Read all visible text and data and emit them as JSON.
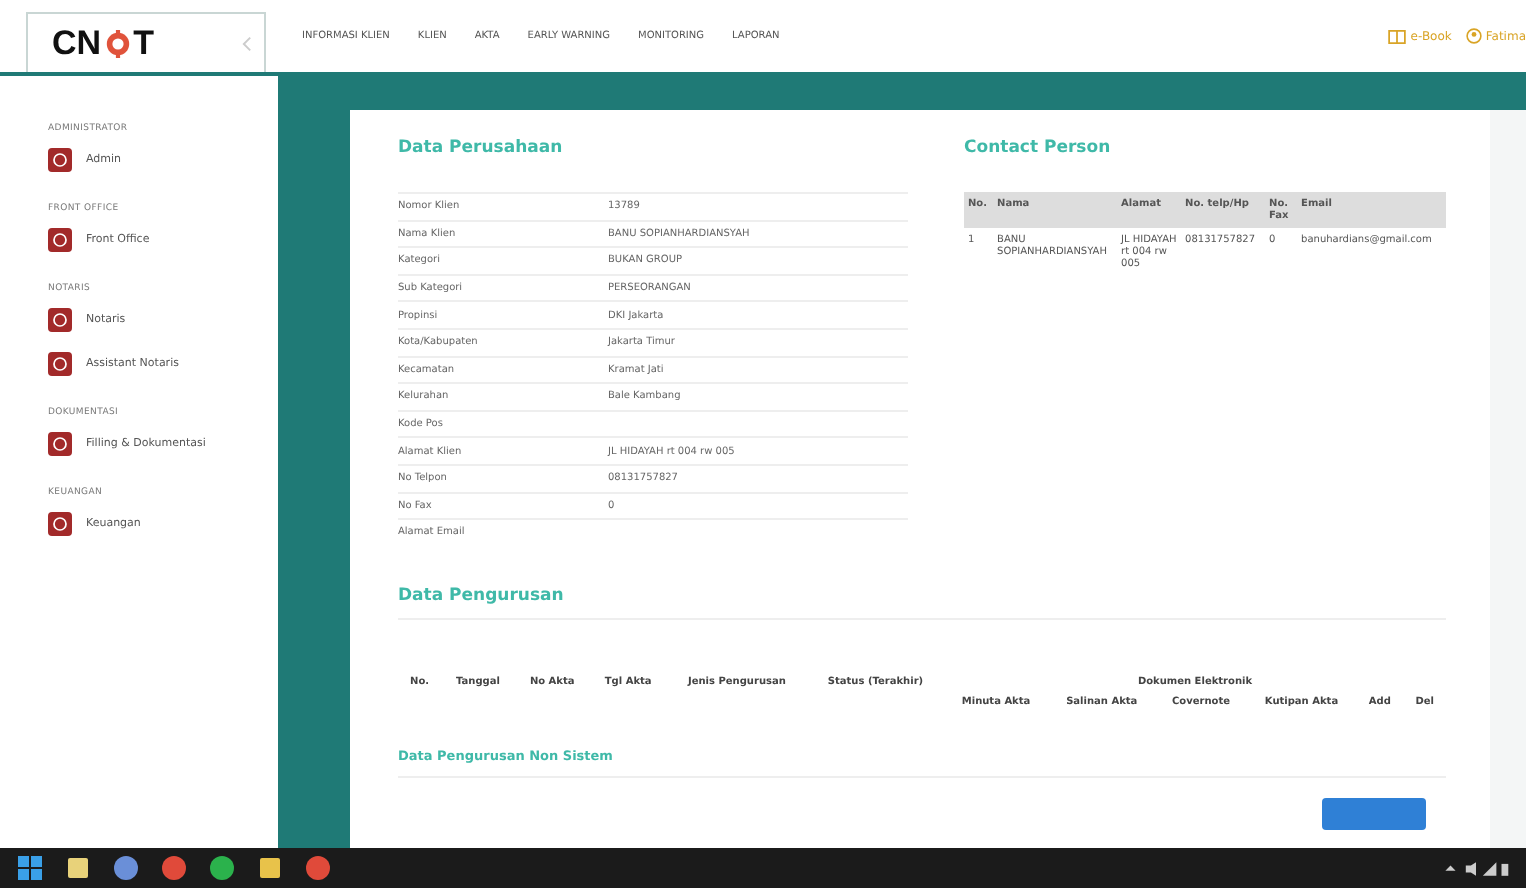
{
  "header": {
    "logo": {
      "before": "CN",
      "after": "T"
    },
    "nav": [
      {
        "label": "INFORMASI KLIEN"
      },
      {
        "label": "KLIEN"
      },
      {
        "label": "AKTA"
      },
      {
        "label": "EARLY WARNING"
      },
      {
        "label": "MONITORING"
      },
      {
        "label": "LAPORAN"
      }
    ],
    "ebook": "e-Book",
    "user": "Fatima"
  },
  "sidebar": {
    "sections": [
      {
        "title": "ADMINISTRATOR",
        "items": [
          {
            "label": "Admin"
          }
        ]
      },
      {
        "title": "FRONT OFFICE",
        "items": [
          {
            "label": "Front Office"
          }
        ]
      },
      {
        "title": "NOTARIS",
        "items": [
          {
            "label": "Notaris"
          },
          {
            "label": "Assistant Notaris"
          }
        ]
      },
      {
        "title": "DOKUMENTASI",
        "items": [
          {
            "label": "Filling & Dokumentasi"
          }
        ]
      },
      {
        "title": "KEUANGAN",
        "items": [
          {
            "label": "Keuangan"
          }
        ]
      }
    ]
  },
  "company": {
    "title": "Data Perusahaan",
    "fields": [
      {
        "label": "Nomor Klien",
        "value": "13789"
      },
      {
        "label": "Nama Klien",
        "value": "BANU SOPIANHARDIANSYAH"
      },
      {
        "label": "Kategori",
        "value": "BUKAN GROUP"
      },
      {
        "label": "Sub Kategori",
        "value": "PERSEORANGAN"
      },
      {
        "label": "Propinsi",
        "value": "DKI Jakarta"
      },
      {
        "label": "Kota/Kabupaten",
        "value": "Jakarta Timur"
      },
      {
        "label": "Kecamatan",
        "value": "Kramat Jati"
      },
      {
        "label": "Kelurahan",
        "value": "Bale Kambang"
      },
      {
        "label": "Kode Pos"
      },
      {
        "label": "Alamat Klien",
        "value": "JL HIDAYAH rt 004 rw 005"
      },
      {
        "label": "No Telpon",
        "value": "08131757827"
      },
      {
        "label": "No Fax",
        "value": "0"
      },
      {
        "label": "Alamat Email"
      }
    ]
  },
  "contact": {
    "title": "Contact Person",
    "columns": [
      "No.",
      "Nama",
      "Alamat",
      "No. telp/Hp",
      "No. Fax",
      "Email"
    ],
    "rows": [
      [
        "1",
        "BANU SOPIANHARDIANSYAH",
        "JL HIDAYAH rt 004 rw 005",
        "08131757827",
        "0",
        "banuhardians@gmail.com"
      ]
    ]
  },
  "pengurusan": {
    "title": "Data Pengurusan",
    "columns": [
      "No.",
      "Tanggal",
      "No Akta",
      "Tgl Akta",
      "Jenis Pengurusan",
      "Status (Terakhir)"
    ],
    "group": "Dokumen Elektronik",
    "subcolumns": [
      "Minuta Akta",
      "Salinan Akta",
      "Covernote",
      "Kutipan Akta",
      "Add",
      "Del"
    ]
  },
  "non_sistem": {
    "title": "Data Pengurusan Non Sistem"
  }
}
